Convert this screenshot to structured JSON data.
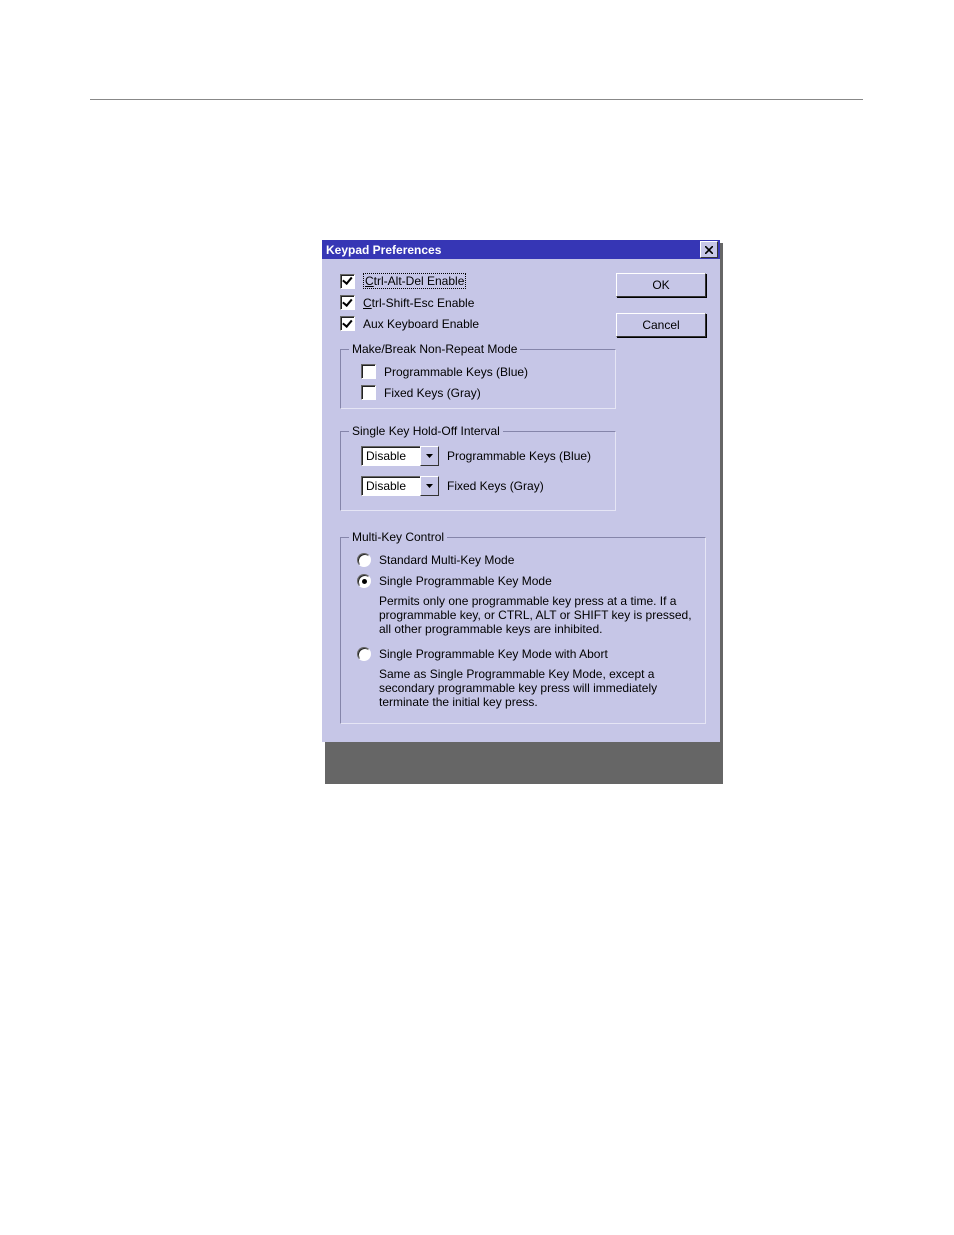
{
  "dialog": {
    "title": "Keypad Preferences",
    "buttons": {
      "ok": "OK",
      "cancel": "Cancel"
    },
    "checks": {
      "ctrl_alt_del": {
        "label_pre": "C",
        "label_post": "trl-Alt-Del Enable",
        "checked": true
      },
      "ctrl_shift_esc": {
        "label_pre": "C",
        "label_post": "trl-Shift-Esc Enable",
        "checked": true
      },
      "aux_keyboard": {
        "label": "Aux Keyboard Enable",
        "checked": true
      }
    },
    "group_make_break": {
      "legend": "Make/Break Non-Repeat Mode",
      "prog_keys": {
        "label": "Programmable Keys (Blue)",
        "checked": false
      },
      "fixed_keys": {
        "label": "Fixed Keys (Gray)",
        "checked": false
      }
    },
    "group_holdoff": {
      "legend": "Single Key Hold-Off Interval",
      "prog": {
        "value": "Disable",
        "label": "Programmable Keys (Blue)"
      },
      "fixed": {
        "value": "Disable",
        "label": "Fixed Keys (Gray)"
      }
    },
    "group_multikey": {
      "legend": "Multi-Key Control",
      "standard": {
        "label": "Standard Multi-Key Mode",
        "selected": false
      },
      "single": {
        "label": "Single Programmable Key Mode",
        "selected": true,
        "desc": "Permits only one programmable key press at a time.  If a programmable key, or CTRL, ALT or SHIFT key is pressed, all other programmable keys are inhibited."
      },
      "single_abort": {
        "label": "Single Programmable Key Mode with Abort",
        "selected": false,
        "desc": "Same as Single Programmable Key Mode, except a secondary programmable key press will immediately terminate the initial key press."
      }
    }
  }
}
